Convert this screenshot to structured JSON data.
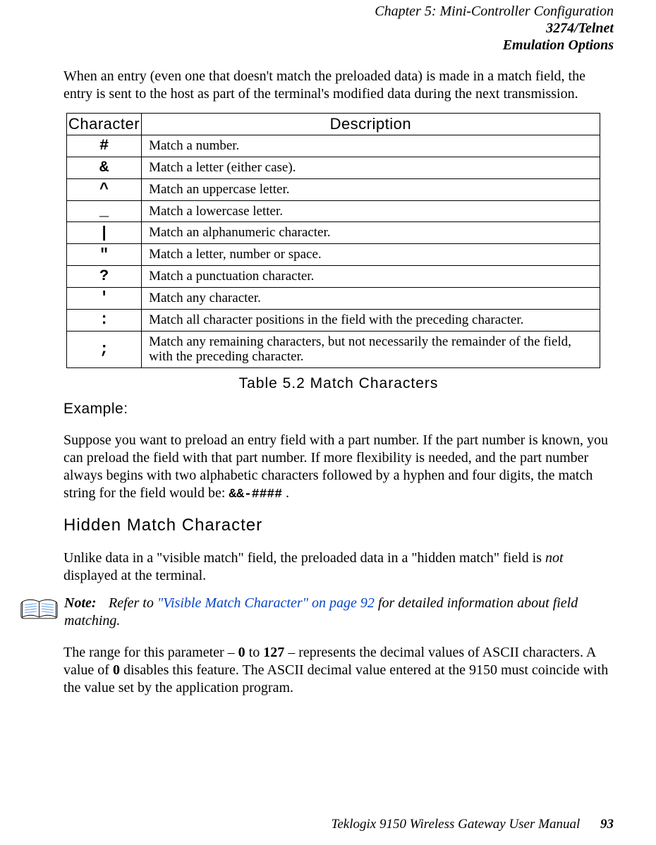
{
  "header": {
    "line1": "Chapter 5:  Mini-Controller Configuration",
    "line2": "3274/Telnet",
    "line3": "Emulation Options"
  },
  "intro": "When an entry (even one that doesn't match the preloaded data) is made in a match field, the entry is sent to the host as part of the terminal's modified data during the next transmission.",
  "table": {
    "head_char": "Character",
    "head_desc": "Description",
    "rows": [
      {
        "sym": "#",
        "desc": "Match a number."
      },
      {
        "sym": "&",
        "desc": "Match a letter (either case)."
      },
      {
        "sym": "^",
        "desc": "Match an uppercase letter."
      },
      {
        "sym": "_",
        "desc": "Match a lowercase letter."
      },
      {
        "sym": "|",
        "desc": "Match an alphanumeric character."
      },
      {
        "sym": "\"",
        "desc": "Match a letter, number or space."
      },
      {
        "sym": "?",
        "desc": "Match a punctuation character."
      },
      {
        "sym": "'",
        "desc": "Match any character."
      },
      {
        "sym": ":",
        "desc": "Match all character positions in the field with the preceding character."
      },
      {
        "sym": ";",
        "desc": "Match any remaining characters, but not necessarily the remainder of the field, with the preceding character."
      }
    ],
    "caption": "Table 5.2 Match Characters"
  },
  "example": {
    "heading": "Example:",
    "text_start": "Suppose you want to preload an entry field with a part number. If the part number is known, you can preload the field with that part number. If more flexibility is needed, and the part number always begins with two alphabetic characters followed by a hyphen and four digits, the match string for the field would be: ",
    "code": "&&-####",
    "text_end": " ."
  },
  "hidden": {
    "heading": "Hidden Match Character",
    "para1_start": "Unlike data in a \"visible match\" field, the preloaded data in a \"hidden match\" field is ",
    "para1_em": "not",
    "para1_end": " displayed at the terminal."
  },
  "note": {
    "label": "Note:",
    "text_start": "Refer to ",
    "link": "\"Visible Match Character\" on page 92",
    "text_end": " for detailed information about field matching."
  },
  "range": {
    "p1": "The range for this parameter – ",
    "b1": "0",
    "p2": " to ",
    "b2": "127",
    "p3": " – represents the decimal values of ASCII characters. A value of ",
    "b3": "0",
    "p4": " disables this feature. The ASCII decimal value entered at the 9150 must coincide with the value set by the application program."
  },
  "footer": {
    "title": "Teklogix 9150 Wireless Gateway User Manual",
    "page": "93"
  }
}
